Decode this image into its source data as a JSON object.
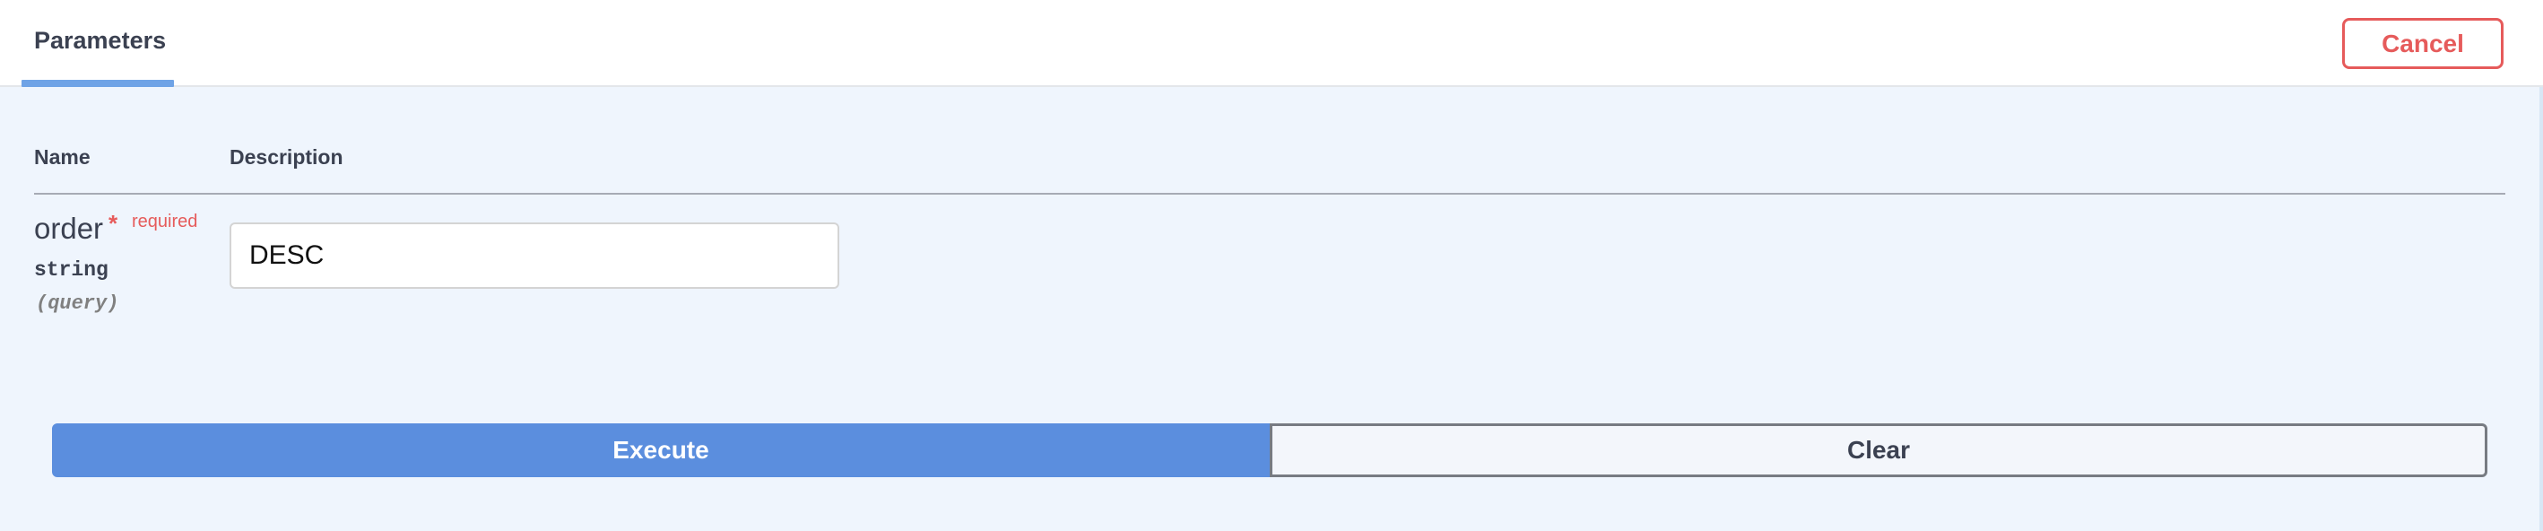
{
  "header": {
    "tab_label": "Parameters",
    "cancel_label": "Cancel"
  },
  "table": {
    "columns": [
      "Name",
      "Description"
    ]
  },
  "parameter": {
    "name": "order",
    "required_marker": "*",
    "required_label": "required",
    "type": "string",
    "location": "(query)",
    "value": "DESC"
  },
  "actions": {
    "execute_label": "Execute",
    "clear_label": "Clear"
  },
  "colors": {
    "accent_blue": "#5b8ede",
    "danger_red": "#e65b5b",
    "panel_bg": "#eff5fd"
  }
}
